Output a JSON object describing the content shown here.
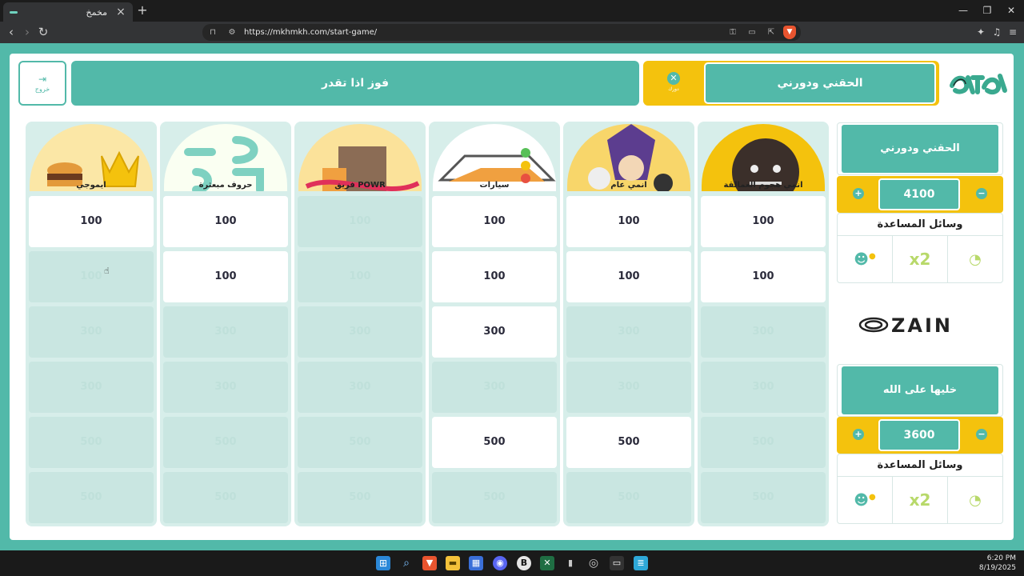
{
  "browser": {
    "tab_title": "مخمخ",
    "tab_close": "×",
    "new_tab": "+",
    "url": "https://mkhmkh.com/start-game/",
    "window": {
      "minimize": "—",
      "restore": "❐",
      "close": "✕"
    }
  },
  "header": {
    "exit_label": "خروج",
    "team_a_banner": "فوز اذا تقدر",
    "turn_team": "الحقني ودورني",
    "turn_icon_sub": "دورك"
  },
  "categories": [
    {
      "label": "انمي هجوم العمالقة"
    },
    {
      "label": "انمي عام"
    },
    {
      "label": "سيارات"
    },
    {
      "label": "فريق POWR"
    },
    {
      "label": "حروف مبعثرة"
    },
    {
      "label": "ايموجي"
    }
  ],
  "grid": {
    "row_values": [
      "100",
      "100",
      "300",
      "300",
      "500",
      "500"
    ],
    "columns": [
      {
        "active": [
          true,
          true,
          false,
          false,
          false,
          false
        ]
      },
      {
        "active": [
          true,
          true,
          false,
          false,
          true,
          false
        ]
      },
      {
        "active": [
          true,
          true,
          true,
          false,
          true,
          false
        ]
      },
      {
        "active": [
          false,
          false,
          false,
          false,
          false,
          false
        ]
      },
      {
        "active": [
          true,
          true,
          false,
          false,
          false,
          false
        ]
      },
      {
        "active": [
          true,
          false,
          false,
          false,
          false,
          false
        ]
      }
    ]
  },
  "teams": [
    {
      "name": "الحقني ودورني",
      "score": "4100",
      "aids_title": "وسائل المساعدة"
    },
    {
      "name": "خليها على الله",
      "score": "3600",
      "aids_title": "وسائل المساعدة"
    }
  ],
  "aids": {
    "x2_label": "x2"
  },
  "sponsor": "ZAIN",
  "taskbar": {
    "time": "6:20 PM",
    "date": "8/19/2025"
  },
  "colors": {
    "teal": "#52b9a9",
    "yellow": "#f4c20d",
    "cell_off": "#c9e6e1",
    "panel": "#d7eeea"
  }
}
